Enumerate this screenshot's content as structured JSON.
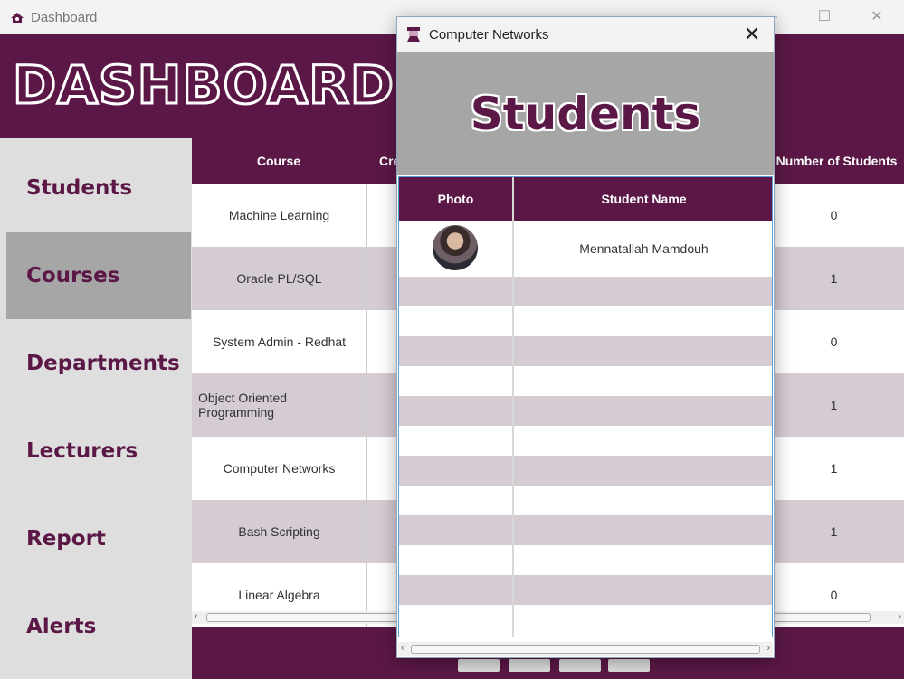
{
  "window": {
    "title": "Dashboard",
    "controls": [
      "—",
      "☐",
      "✕"
    ]
  },
  "header": {
    "title": "DASHBOARD"
  },
  "sidebar": {
    "items": [
      {
        "label": "Students",
        "active": false
      },
      {
        "label": "Courses",
        "active": true
      },
      {
        "label": "Departments",
        "active": false
      },
      {
        "label": "Lecturers",
        "active": false
      },
      {
        "label": "Report",
        "active": false
      },
      {
        "label": "Alerts",
        "active": false
      }
    ]
  },
  "courses_table": {
    "columns": [
      "Course",
      "Cre",
      "Number of Students"
    ],
    "rows": [
      {
        "course": "Machine Learning",
        "students": "0"
      },
      {
        "course": "Oracle PL/SQL",
        "students": "1"
      },
      {
        "course": "System Admin - Redhat",
        "students": "0"
      },
      {
        "course": "Object Oriented Programming",
        "students": "1"
      },
      {
        "course": "Computer Networks",
        "students": "1"
      },
      {
        "course": "Bash Scripting",
        "students": "1"
      },
      {
        "course": "Linear Algebra",
        "students": "0"
      }
    ]
  },
  "modal": {
    "title": "Computer Networks",
    "banner": "Students",
    "columns": [
      "Photo",
      "Student Name"
    ],
    "rows": [
      {
        "photo": "avatar",
        "name": "Mennatallah Mamdouh"
      }
    ],
    "close_icon": "✕"
  },
  "colors": {
    "brand": "#5b1846",
    "row_alt": "#d5cbd3",
    "sidebar_bg": "#dedede",
    "active_item": "#a6a6a6"
  }
}
